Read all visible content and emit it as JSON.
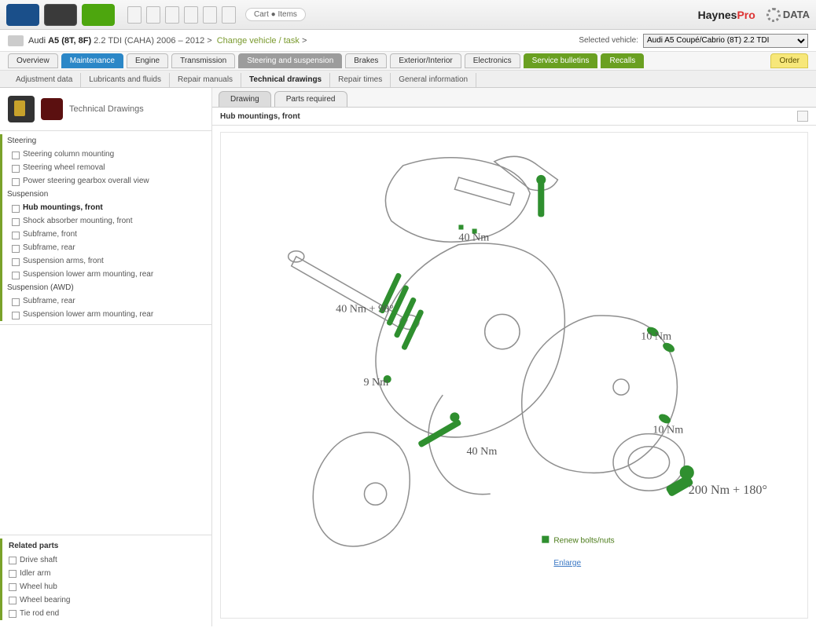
{
  "topbar": {
    "user": "Cart ● Items",
    "brand1": "Haynes",
    "brand1b": "Pro",
    "brand2": "DATA"
  },
  "breadcrumb": {
    "prefix": "Audi",
    "model": "A5 (8T, 8F)",
    "variant": "2.2 TDI (CAHA) 2006 – 2012",
    "sep": ">",
    "link": "Change vehicle / task",
    "arrow": ">",
    "selected_label": "Selected vehicle:",
    "selected_value": "Audi A5 Coupé/Cabrio (8T) 2.2 TDI"
  },
  "tabs_main": [
    {
      "label": "Overview",
      "style": ""
    },
    {
      "label": "Maintenance",
      "style": "sel"
    },
    {
      "label": "Engine",
      "style": ""
    },
    {
      "label": "Transmission",
      "style": ""
    },
    {
      "label": "Steering and suspension",
      "style": "grey"
    },
    {
      "label": "Brakes",
      "style": ""
    },
    {
      "label": "Exterior/Interior",
      "style": ""
    },
    {
      "label": "Electronics",
      "style": ""
    },
    {
      "label": "Service bulletins",
      "style": "green"
    },
    {
      "label": "Recalls",
      "style": "green"
    }
  ],
  "tab_right": {
    "label": "Order"
  },
  "tabs_sub": [
    {
      "label": "Adjustment data",
      "active": false
    },
    {
      "label": "Lubricants and fluids",
      "active": false
    },
    {
      "label": "Repair manuals",
      "active": false
    },
    {
      "label": "Technical drawings",
      "active": true
    },
    {
      "label": "Repair times",
      "active": false
    },
    {
      "label": "General information",
      "active": false
    }
  ],
  "section_title": "Technical Drawings",
  "tree": [
    {
      "type": "grp",
      "label": "Steering"
    },
    {
      "type": "item",
      "label": "Steering column mounting"
    },
    {
      "type": "item",
      "label": "Steering wheel removal"
    },
    {
      "type": "item",
      "label": "Power steering gearbox overall view"
    },
    {
      "type": "grp",
      "label": "Suspension"
    },
    {
      "type": "item",
      "label": "Hub mountings, front",
      "active": true
    },
    {
      "type": "item",
      "label": "Shock absorber mounting, front"
    },
    {
      "type": "item",
      "label": "Subframe, front"
    },
    {
      "type": "item",
      "label": "Subframe, rear"
    },
    {
      "type": "item",
      "label": "Suspension arms, front"
    },
    {
      "type": "item",
      "label": "Suspension lower arm mounting, rear"
    },
    {
      "type": "grp",
      "label": "Suspension (AWD)"
    },
    {
      "type": "item",
      "label": "Subframe, rear"
    },
    {
      "type": "item",
      "label": "Suspension lower arm mounting, rear"
    }
  ],
  "related": {
    "heading": "Related parts",
    "items": [
      "Drive shaft",
      "Idler arm",
      "Wheel hub",
      "Wheel bearing",
      "Tie rod end"
    ]
  },
  "doc_tabs": [
    {
      "label": "Drawing",
      "on": true
    },
    {
      "label": "Parts required",
      "on": false
    }
  ],
  "doc_title": "Hub mountings, front",
  "torques": {
    "a": "40 Nm",
    "b": "40 Nm + 90°",
    "c": "9 Nm",
    "d": "10 Nm",
    "e": "40 Nm",
    "f": "10 Nm",
    "g": "200 Nm + 180°"
  },
  "legend": "Renew bolts/nuts",
  "bottom_link": "Enlarge"
}
